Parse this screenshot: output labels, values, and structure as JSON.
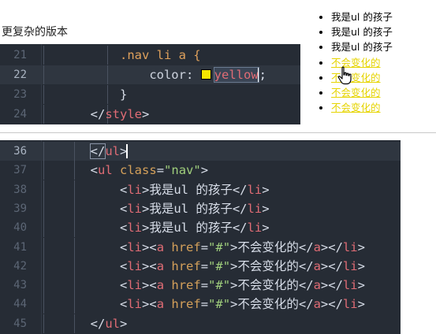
{
  "caption": "更复杂的版本",
  "editor_top": {
    "lines": [
      {
        "n": "21",
        "tokens": [
          {
            "t": "            "
          },
          {
            "t": ".nav li a {",
            "c": "sel"
          }
        ]
      },
      {
        "n": "22",
        "tokens": [
          {
            "t": "                "
          },
          {
            "t": "color",
            "c": "prop"
          },
          {
            "t": ": ",
            "c": "punc"
          }
        ],
        "swatch": true,
        "value": "yellow",
        "tail": ";",
        "active": true
      },
      {
        "n": "23",
        "tokens": [
          {
            "t": "            "
          },
          {
            "t": "}",
            "c": "punc"
          }
        ]
      },
      {
        "n": "24",
        "tokens": [
          {
            "t": "        "
          },
          {
            "t": "</",
            "c": "punc"
          },
          {
            "t": "style",
            "c": "tag"
          },
          {
            "t": ">",
            "c": "punc"
          }
        ]
      }
    ]
  },
  "editor_bottom": {
    "lines": [
      {
        "n": "36",
        "tokens": [
          {
            "t": "        "
          },
          {
            "t": "</",
            "c": "punc"
          },
          {
            "t": "ul",
            "c": "tag"
          },
          {
            "t": ">",
            "c": "punc"
          }
        ],
        "active": true,
        "match": true
      },
      {
        "n": "37",
        "tokens": [
          {
            "t": "        "
          },
          {
            "t": "<",
            "c": "punc"
          },
          {
            "t": "ul",
            "c": "tag"
          },
          {
            "t": " "
          },
          {
            "t": "class",
            "c": "attr"
          },
          {
            "t": "=",
            "c": "punc"
          },
          {
            "t": "\"nav\"",
            "c": "str"
          },
          {
            "t": ">",
            "c": "punc"
          }
        ]
      },
      {
        "n": "38",
        "tokens": [
          {
            "t": "            "
          },
          {
            "t": "<",
            "c": "punc"
          },
          {
            "t": "li",
            "c": "tag"
          },
          {
            "t": ">",
            "c": "punc"
          },
          {
            "t": "我是ul 的孩子",
            "c": "text"
          },
          {
            "t": "</",
            "c": "punc"
          },
          {
            "t": "li",
            "c": "tag"
          },
          {
            "t": ">",
            "c": "punc"
          }
        ]
      },
      {
        "n": "39",
        "tokens": [
          {
            "t": "            "
          },
          {
            "t": "<",
            "c": "punc"
          },
          {
            "t": "li",
            "c": "tag"
          },
          {
            "t": ">",
            "c": "punc"
          },
          {
            "t": "我是ul 的孩子",
            "c": "text"
          },
          {
            "t": "</",
            "c": "punc"
          },
          {
            "t": "li",
            "c": "tag"
          },
          {
            "t": ">",
            "c": "punc"
          }
        ]
      },
      {
        "n": "40",
        "tokens": [
          {
            "t": "            "
          },
          {
            "t": "<",
            "c": "punc"
          },
          {
            "t": "li",
            "c": "tag"
          },
          {
            "t": ">",
            "c": "punc"
          },
          {
            "t": "我是ul 的孩子",
            "c": "text"
          },
          {
            "t": "</",
            "c": "punc"
          },
          {
            "t": "li",
            "c": "tag"
          },
          {
            "t": ">",
            "c": "punc"
          }
        ]
      },
      {
        "n": "41",
        "tokens": [
          {
            "t": "            "
          },
          {
            "t": "<",
            "c": "punc"
          },
          {
            "t": "li",
            "c": "tag"
          },
          {
            "t": ">",
            "c": "punc"
          },
          {
            "t": "<",
            "c": "punc"
          },
          {
            "t": "a",
            "c": "tag"
          },
          {
            "t": " "
          },
          {
            "t": "href",
            "c": "attr"
          },
          {
            "t": "=",
            "c": "punc"
          },
          {
            "t": "\"#\"",
            "c": "str"
          },
          {
            "t": ">",
            "c": "punc"
          },
          {
            "t": "不会变化的",
            "c": "text"
          },
          {
            "t": "</",
            "c": "punc"
          },
          {
            "t": "a",
            "c": "tag"
          },
          {
            "t": "></",
            "c": "punc"
          },
          {
            "t": "li",
            "c": "tag"
          },
          {
            "t": ">",
            "c": "punc"
          }
        ]
      },
      {
        "n": "42",
        "tokens": [
          {
            "t": "            "
          },
          {
            "t": "<",
            "c": "punc"
          },
          {
            "t": "li",
            "c": "tag"
          },
          {
            "t": ">",
            "c": "punc"
          },
          {
            "t": "<",
            "c": "punc"
          },
          {
            "t": "a",
            "c": "tag"
          },
          {
            "t": " "
          },
          {
            "t": "href",
            "c": "attr"
          },
          {
            "t": "=",
            "c": "punc"
          },
          {
            "t": "\"#\"",
            "c": "str"
          },
          {
            "t": ">",
            "c": "punc"
          },
          {
            "t": "不会变化的",
            "c": "text"
          },
          {
            "t": "</",
            "c": "punc"
          },
          {
            "t": "a",
            "c": "tag"
          },
          {
            "t": "></",
            "c": "punc"
          },
          {
            "t": "li",
            "c": "tag"
          },
          {
            "t": ">",
            "c": "punc"
          }
        ]
      },
      {
        "n": "43",
        "tokens": [
          {
            "t": "            "
          },
          {
            "t": "<",
            "c": "punc"
          },
          {
            "t": "li",
            "c": "tag"
          },
          {
            "t": ">",
            "c": "punc"
          },
          {
            "t": "<",
            "c": "punc"
          },
          {
            "t": "a",
            "c": "tag"
          },
          {
            "t": " "
          },
          {
            "t": "href",
            "c": "attr"
          },
          {
            "t": "=",
            "c": "punc"
          },
          {
            "t": "\"#\"",
            "c": "str"
          },
          {
            "t": ">",
            "c": "punc"
          },
          {
            "t": "不会变化的",
            "c": "text"
          },
          {
            "t": "</",
            "c": "punc"
          },
          {
            "t": "a",
            "c": "tag"
          },
          {
            "t": "></",
            "c": "punc"
          },
          {
            "t": "li",
            "c": "tag"
          },
          {
            "t": ">",
            "c": "punc"
          }
        ]
      },
      {
        "n": "44",
        "tokens": [
          {
            "t": "            "
          },
          {
            "t": "<",
            "c": "punc"
          },
          {
            "t": "li",
            "c": "tag"
          },
          {
            "t": ">",
            "c": "punc"
          },
          {
            "t": "<",
            "c": "punc"
          },
          {
            "t": "a",
            "c": "tag"
          },
          {
            "t": " "
          },
          {
            "t": "href",
            "c": "attr"
          },
          {
            "t": "=",
            "c": "punc"
          },
          {
            "t": "\"#\"",
            "c": "str"
          },
          {
            "t": ">",
            "c": "punc"
          },
          {
            "t": "不会变化的",
            "c": "text"
          },
          {
            "t": "</",
            "c": "punc"
          },
          {
            "t": "a",
            "c": "tag"
          },
          {
            "t": "></",
            "c": "punc"
          },
          {
            "t": "li",
            "c": "tag"
          },
          {
            "t": ">",
            "c": "punc"
          }
        ]
      },
      {
        "n": "45",
        "tokens": [
          {
            "t": "        "
          },
          {
            "t": "</",
            "c": "punc"
          },
          {
            "t": "ul",
            "c": "tag"
          },
          {
            "t": ">",
            "c": "punc"
          }
        ]
      }
    ]
  },
  "preview": {
    "items": [
      {
        "text": "我是ul 的孩子",
        "link": false
      },
      {
        "text": "我是ul 的孩子",
        "link": false
      },
      {
        "text": "我是ul 的孩子",
        "link": false
      },
      {
        "text": "不会变化的",
        "link": true
      },
      {
        "text": "不会变化的",
        "link": true
      },
      {
        "text": "不会变化的",
        "link": true
      },
      {
        "text": "不会变化的",
        "link": true
      }
    ],
    "link_color": "#e6d400"
  },
  "colors": {
    "editor_bg": "#262c35",
    "swatch": "#f5e600"
  },
  "icons": {
    "pointer": "hand-pointer-icon"
  }
}
